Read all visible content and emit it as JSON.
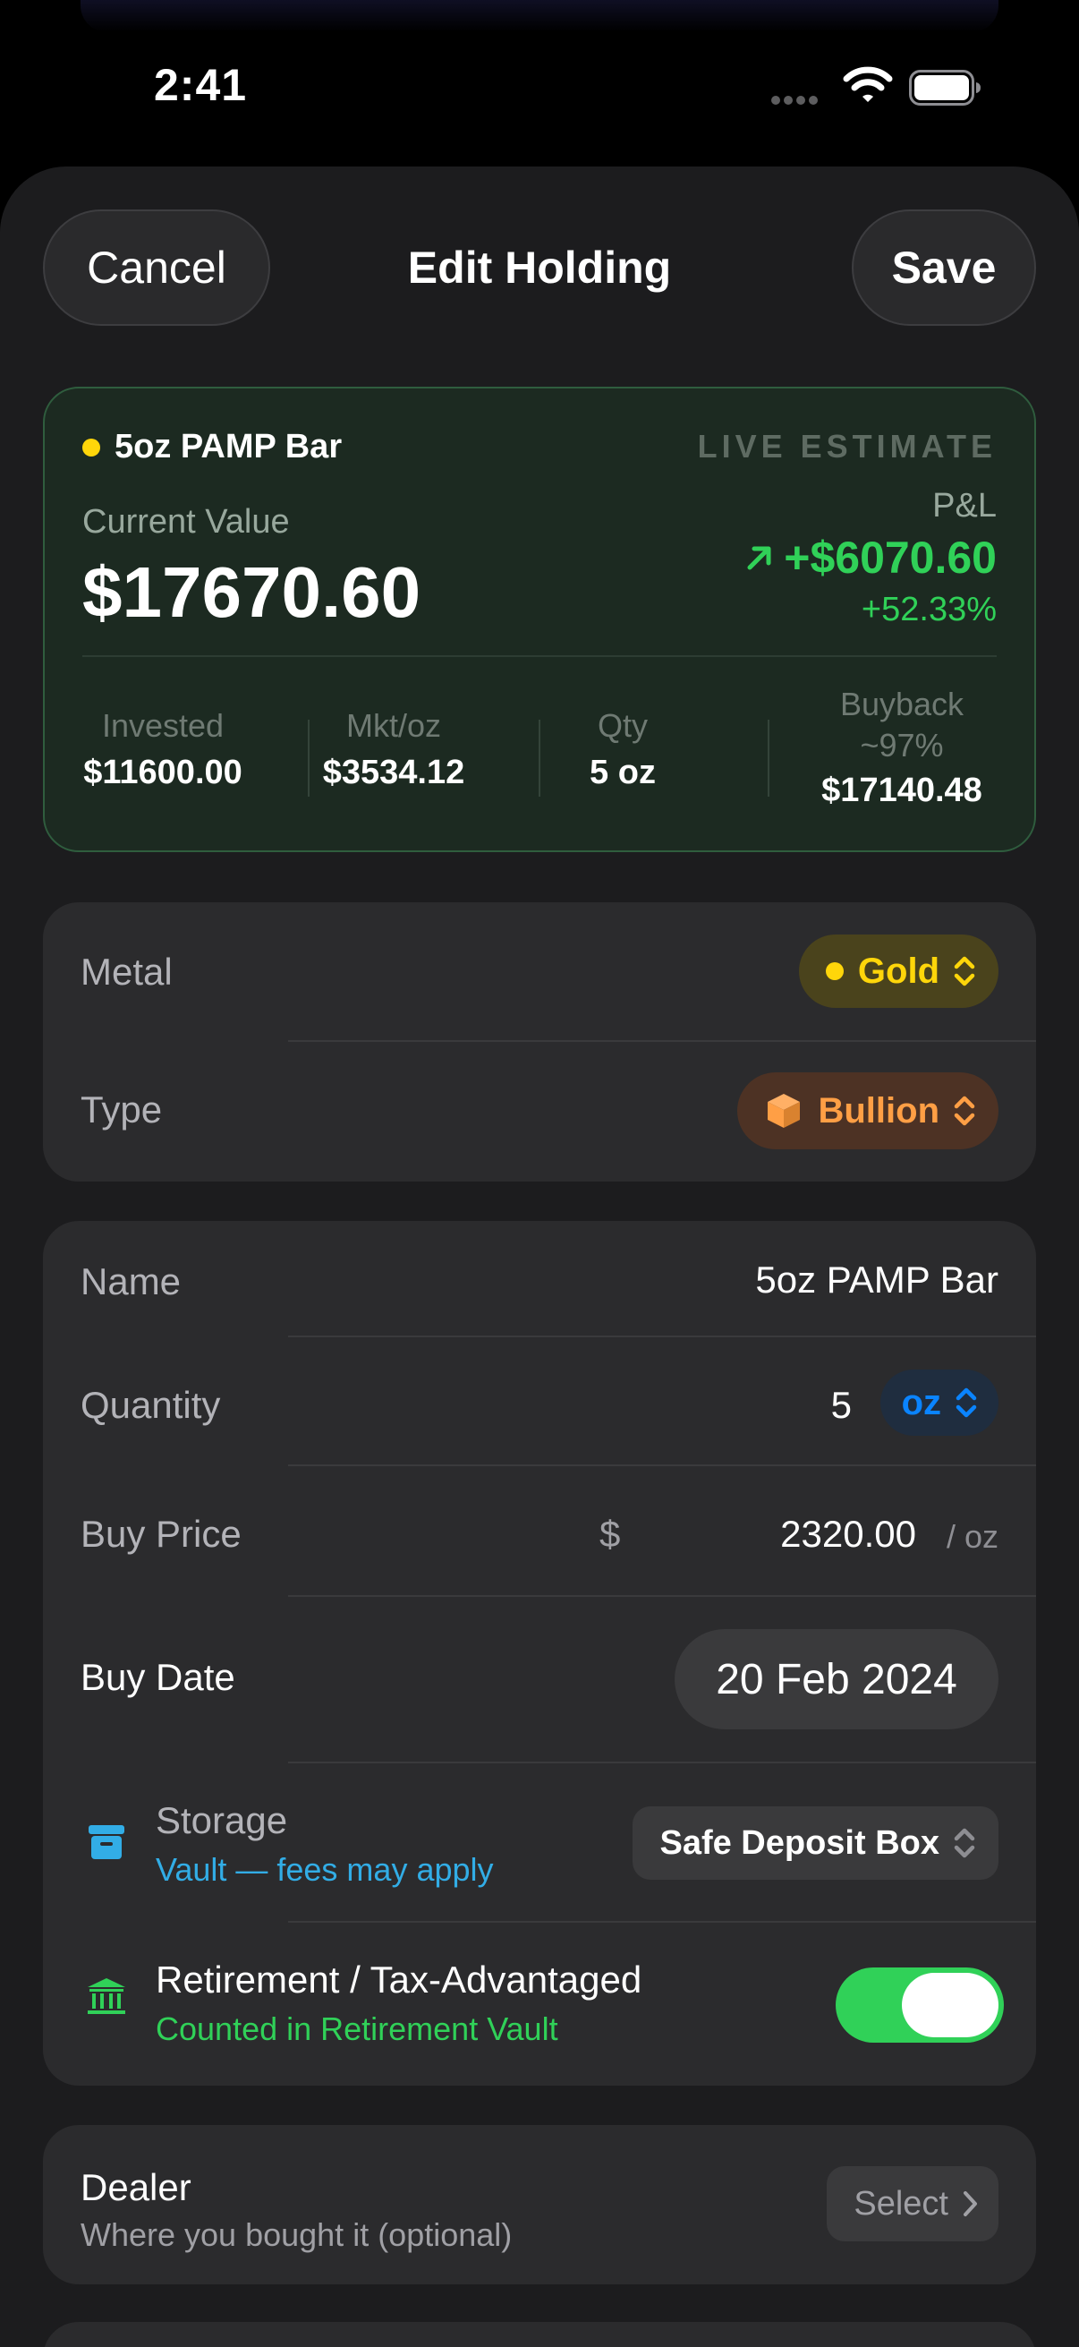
{
  "status_bar": {
    "time": "2:41"
  },
  "nav": {
    "cancel": "Cancel",
    "title": "Edit Holding",
    "save": "Save"
  },
  "estimate": {
    "holding_name": "5oz PAMP Bar",
    "badge": "LIVE ESTIMATE",
    "current_value_label": "Current Value",
    "current_value": "$17670.60",
    "pl_label": "P&L",
    "pl_value": "+$6070.60",
    "pl_percent": "+52.33%",
    "stats": [
      {
        "label": "Invested",
        "value": "$11600.00"
      },
      {
        "label": "Mkt/oz",
        "value": "$3534.12"
      },
      {
        "label": "Qty",
        "value": "5 oz"
      },
      {
        "label": "Buyback ~97%",
        "value": "$17140.48"
      }
    ],
    "colors": {
      "gain": "#30d158",
      "metal_dot": "#ffd60a"
    }
  },
  "classification": {
    "metal_label": "Metal",
    "metal_value": "Gold",
    "type_label": "Type",
    "type_value": "Bullion"
  },
  "details": {
    "name_label": "Name",
    "name_value": "5oz PAMP Bar",
    "quantity_label": "Quantity",
    "quantity_value": "5",
    "quantity_unit": "oz",
    "buy_price_label": "Buy Price",
    "currency_symbol": "$",
    "buy_price_value": "2320.00",
    "buy_price_unit": "/ oz",
    "buy_date_label": "Buy Date",
    "buy_date_value": "20 Feb 2024",
    "storage_label": "Storage",
    "storage_hint": "Vault — fees may apply",
    "storage_value": "Safe Deposit Box",
    "retirement_label": "Retirement / Tax-Advantaged",
    "retirement_hint": "Counted in Retirement Vault",
    "retirement_enabled": true
  },
  "dealer": {
    "label": "Dealer",
    "hint": "Where you bought it (optional)",
    "select_label": "Select"
  }
}
